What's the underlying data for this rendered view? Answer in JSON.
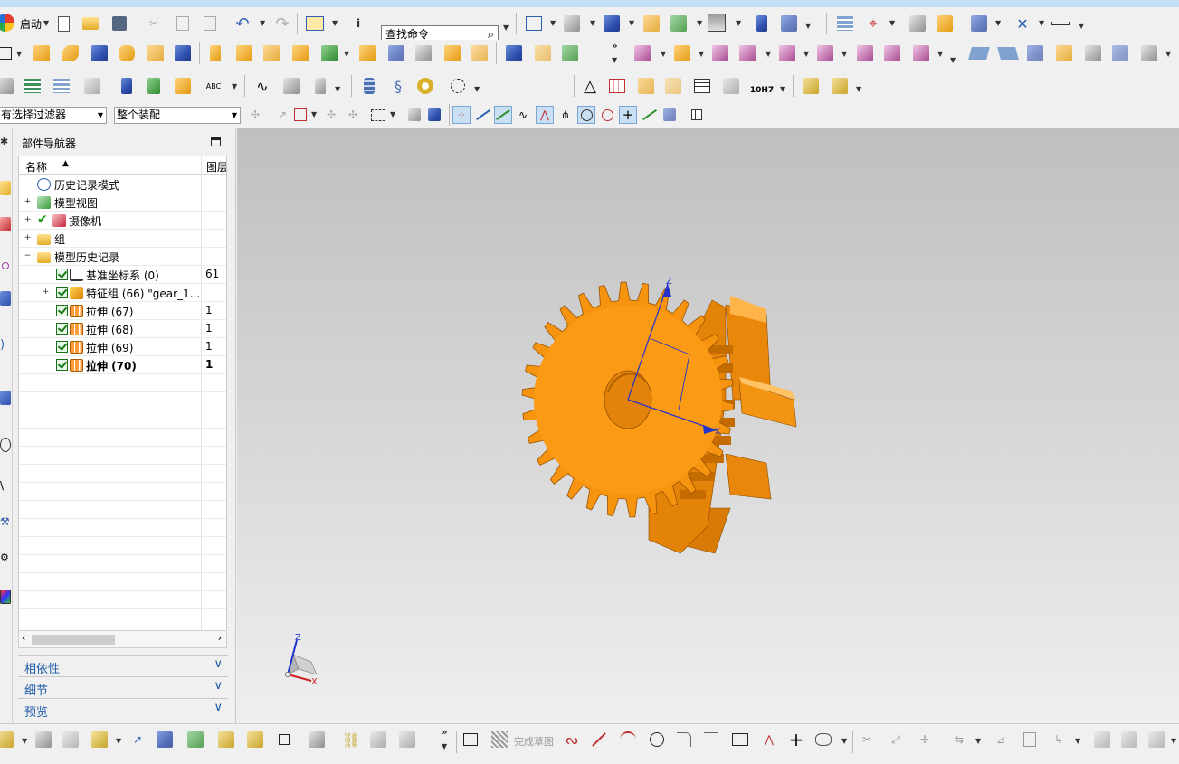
{
  "toolbar": {
    "start_label": "启动",
    "search_value": "查找命令",
    "finish_sketch_label": "完成草图",
    "units_label": "10H7",
    "text_style_label": "ABC"
  },
  "selection_bar": {
    "filter_value": "有选择过滤器",
    "scope_value": "整个装配"
  },
  "navigator": {
    "title": "部件导航器",
    "col_name": "名称",
    "col_layer": "图层",
    "rows": [
      {
        "label": "历史记录模式",
        "layer": ""
      },
      {
        "label": "模型视图",
        "layer": ""
      },
      {
        "label": "摄像机",
        "layer": ""
      },
      {
        "label": "组",
        "layer": ""
      },
      {
        "label": "模型历史记录",
        "layer": ""
      },
      {
        "label": "基准坐标系 (0)",
        "layer": "61"
      },
      {
        "label": "特征组 (66) \"gear_1...",
        "layer": ""
      },
      {
        "label": "拉伸 (67)",
        "layer": "1"
      },
      {
        "label": "拉伸 (68)",
        "layer": "1"
      },
      {
        "label": "拉伸 (69)",
        "layer": "1"
      },
      {
        "label": "拉伸 (70)",
        "layer": "1"
      }
    ]
  },
  "panels": {
    "dependencies": "相依性",
    "details": "细节",
    "preview": "预览"
  },
  "viewport": {
    "axis_z": "Z",
    "axis_x": "X",
    "triad_z": "Z",
    "triad_x": "X"
  },
  "colors": {
    "gear": "#f7940f",
    "accent": "#1c5aa8"
  }
}
